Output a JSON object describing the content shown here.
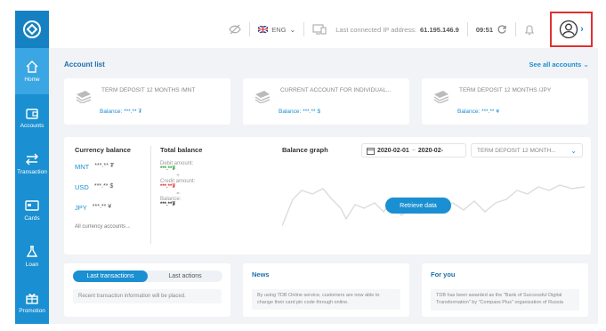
{
  "sidebar": {
    "items": [
      {
        "label": "Home",
        "icon": "home-icon",
        "active": true
      },
      {
        "label": "Accounts",
        "icon": "wallet-icon"
      },
      {
        "label": "Transaction",
        "icon": "transfer-icon"
      },
      {
        "label": "Cards",
        "icon": "card-icon"
      },
      {
        "label": "Loan",
        "icon": "loan-icon"
      },
      {
        "label": "Promotion",
        "icon": "gift-icon"
      }
    ]
  },
  "topbar": {
    "language": "ENG",
    "ip_label": "Last connected IP address:",
    "ip_value": "61.195.146.9",
    "time": "09:51"
  },
  "accounts": {
    "title": "Account list",
    "see_all": "See all accounts",
    "cards": [
      {
        "name": "TERM DEPOSIT 12 MONTHS /MNT",
        "balance": "Balance: ***.** ₮"
      },
      {
        "name": "CURRENT ACCOUNT FOR INDIVIDUAL...",
        "balance": "Balance: ***.** $"
      },
      {
        "name": "TERM DEPOSIT 12 MONTHS /JPY",
        "balance": "Balance: ***.** ¥"
      }
    ]
  },
  "currency_balance": {
    "title": "Currency balance",
    "rows": [
      {
        "code": "MNT",
        "value": "***.** ₮"
      },
      {
        "code": "USD",
        "value": "***.** $"
      },
      {
        "code": "JPY",
        "value": "***.** ¥"
      }
    ],
    "all_link": "All currency accounts→"
  },
  "total_balance": {
    "title": "Total balance",
    "debit_label": "Debit amount:",
    "debit_value": "***.**₮",
    "plus": "+",
    "credit_label": "Credit amount:",
    "credit_value": "***.**₮",
    "equals": "=",
    "balance_label": "Balance:",
    "balance_value": "***.**₮"
  },
  "balance_graph": {
    "title": "Balance graph",
    "date_from": "2020-02-01",
    "date_sep": "~",
    "date_to": "2020-02-",
    "account_select": "TERM DEPOSIT 12 MONTH...",
    "retrieve": "Retrieve data"
  },
  "transactions": {
    "tab_active": "Last transactions",
    "tab_other": "Last actions",
    "empty": "Recent transaction information will be placed."
  },
  "news": {
    "title": "News",
    "text": "By using TDB Online service, customers are now able to change their card pin code through online."
  },
  "for_you": {
    "title": "For you",
    "text": "TDB has been awarded as the \"Bank of Successful Digital Transformation\" by \"Compass Plus\" organization of Russia"
  },
  "colors": {
    "accent": "#1a8fd1",
    "sidebar": "#1a8fd1",
    "highlight": "#e03030"
  }
}
